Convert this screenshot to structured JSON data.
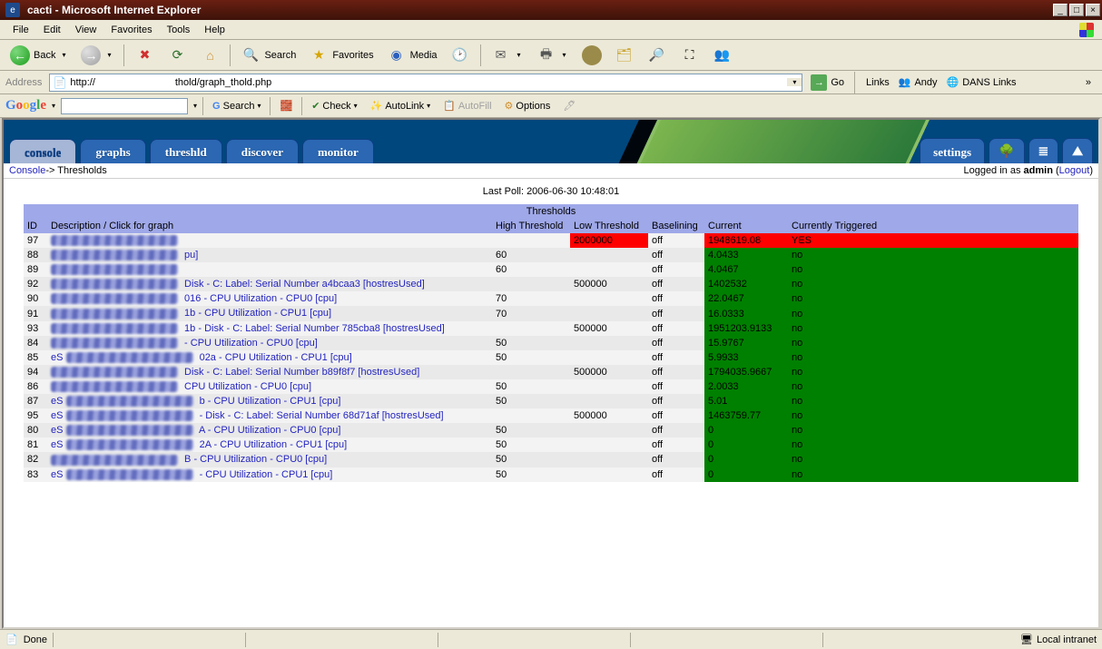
{
  "window": {
    "title": "cacti - Microsoft Internet Explorer"
  },
  "menubar": {
    "file": "File",
    "edit": "Edit",
    "view": "View",
    "favorites": "Favorites",
    "tools": "Tools",
    "help": "Help"
  },
  "toolbar": {
    "back": "Back",
    "search": "Search",
    "favorites": "Favorites",
    "media": "Media"
  },
  "address": {
    "label": "Address",
    "url_prefix": "http://",
    "url_suffix": "thold/graph_thold.php",
    "go": "Go",
    "links_label": "Links",
    "link1": "Andy",
    "link2": "DANS Links"
  },
  "google": {
    "search": "Search",
    "check": "Check",
    "autolink": "AutoLink",
    "autofill": "AutoFill",
    "options": "Options"
  },
  "cacti": {
    "tabs": {
      "console": "console",
      "graphs": "graphs",
      "threshld": "threshld",
      "discover": "discover",
      "monitor": "monitor"
    },
    "settings": "settings",
    "breadcrumb_console": "Console",
    "breadcrumb_rest": " -> Thresholds",
    "logged_in_pre": "Logged in as ",
    "logged_in_user": "admin",
    "logout": "Logout",
    "last_poll": "Last Poll: 2006-06-30 10:48:01",
    "section_title": "Thresholds",
    "columns": {
      "id": "ID",
      "desc": "Description / Click for graph",
      "hi": "High Threshold",
      "lo": "Low Threshold",
      "bl": "Baselining",
      "cur": "Current",
      "trig": "Currently Triggered"
    },
    "rows": [
      {
        "id": "97",
        "desc": "",
        "hi": "",
        "lo": "2000000",
        "lo_alert": true,
        "bl": "off",
        "cur": "1948619.08",
        "cur_alert": true,
        "trig": "YES",
        "trig_alert": true
      },
      {
        "id": "88",
        "desc": "pu]",
        "hi": "60",
        "lo": "",
        "bl": "off",
        "cur": "4.0433",
        "trig": "no"
      },
      {
        "id": "89",
        "desc": "",
        "hi": "60",
        "lo": "",
        "bl": "off",
        "cur": "4.0467",
        "trig": "no"
      },
      {
        "id": "92",
        "desc": "Disk - C: Label: Serial Number a4bcaa3 [hostresUsed]",
        "hi": "",
        "lo": "500000",
        "bl": "off",
        "cur": "1402532",
        "trig": "no"
      },
      {
        "id": "90",
        "desc": "016 - CPU Utilization - CPU0 [cpu]",
        "hi": "70",
        "lo": "",
        "bl": "off",
        "cur": "22.0467",
        "trig": "no"
      },
      {
        "id": "91",
        "desc": "1b - CPU Utilization - CPU1 [cpu]",
        "hi": "70",
        "lo": "",
        "bl": "off",
        "cur": "16.0333",
        "trig": "no"
      },
      {
        "id": "93",
        "desc": "1b - Disk - C: Label: Serial Number 785cba8 [hostresUsed]",
        "hi": "",
        "lo": "500000",
        "bl": "off",
        "cur": "1951203.9133",
        "trig": "no"
      },
      {
        "id": "84",
        "desc": "- CPU Utilization - CPU0 [cpu]",
        "hi": "50",
        "lo": "",
        "bl": "off",
        "cur": "15.9767",
        "trig": "no"
      },
      {
        "id": "85",
        "desc": "02a - CPU Utilization - CPU1 [cpu]",
        "pre": "eS",
        "hi": "50",
        "lo": "",
        "bl": "off",
        "cur": "5.9933",
        "trig": "no"
      },
      {
        "id": "94",
        "desc": "Disk - C: Label: Serial Number b89f8f7 [hostresUsed]",
        "hi": "",
        "lo": "500000",
        "bl": "off",
        "cur": "1794035.9667",
        "trig": "no"
      },
      {
        "id": "86",
        "desc": "CPU Utilization - CPU0 [cpu]",
        "hi": "50",
        "lo": "",
        "bl": "off",
        "cur": "2.0033",
        "trig": "no"
      },
      {
        "id": "87",
        "desc": "b - CPU Utilization - CPU1 [cpu]",
        "pre": "eS",
        "hi": "50",
        "lo": "",
        "bl": "off",
        "cur": "5.01",
        "trig": "no"
      },
      {
        "id": "95",
        "desc": "- Disk - C: Label: Serial Number 68d71af [hostresUsed]",
        "pre": "eS",
        "hi": "",
        "lo": "500000",
        "bl": "off",
        "cur": "1463759.77",
        "trig": "no"
      },
      {
        "id": "80",
        "desc": "A - CPU Utilization - CPU0 [cpu]",
        "pre": "eS",
        "hi": "50",
        "lo": "",
        "bl": "off",
        "cur": "0",
        "trig": "no"
      },
      {
        "id": "81",
        "desc": "2A - CPU Utilization - CPU1 [cpu]",
        "pre": "eS",
        "hi": "50",
        "lo": "",
        "bl": "off",
        "cur": "0",
        "trig": "no"
      },
      {
        "id": "82",
        "desc": "B - CPU Utilization - CPU0 [cpu]",
        "hi": "50",
        "lo": "",
        "bl": "off",
        "cur": "0",
        "trig": "no"
      },
      {
        "id": "83",
        "desc": "- CPU Utilization - CPU1 [cpu]",
        "pre": "eS",
        "hi": "50",
        "lo": "",
        "bl": "off",
        "cur": "0",
        "trig": "no"
      }
    ]
  },
  "status": {
    "done": "Done",
    "zone": "Local intranet"
  }
}
